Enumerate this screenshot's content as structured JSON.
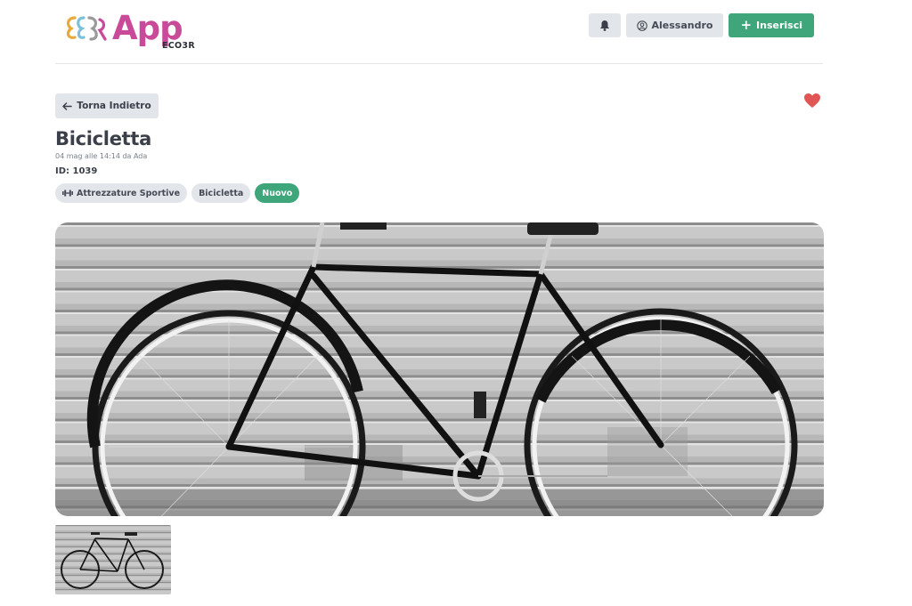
{
  "brand": {
    "name": "App",
    "sub": "ECO3R"
  },
  "header": {
    "user_label": "Alessandro",
    "insert_label": "Inserisci"
  },
  "back_label": "Torna Indietro",
  "item": {
    "title": "Bicicletta",
    "meta": "04 mag alle 14:14 da Ada",
    "id": "ID: 1039"
  },
  "tags": [
    {
      "label": "Attrezzature Sportive",
      "icon": "dumbbell-icon"
    },
    {
      "label": "Bicicletta"
    },
    {
      "label": "Nuovo"
    }
  ],
  "colors": {
    "brand_pink": "#c94a98",
    "accent_green": "#3fa57a",
    "heart_red": "#e25555",
    "button_gray": "#e2e5ea"
  },
  "icons": [
    "bell-icon",
    "user-circle-icon",
    "plus-icon",
    "arrow-left-icon",
    "heart-icon",
    "dumbbell-icon"
  ]
}
